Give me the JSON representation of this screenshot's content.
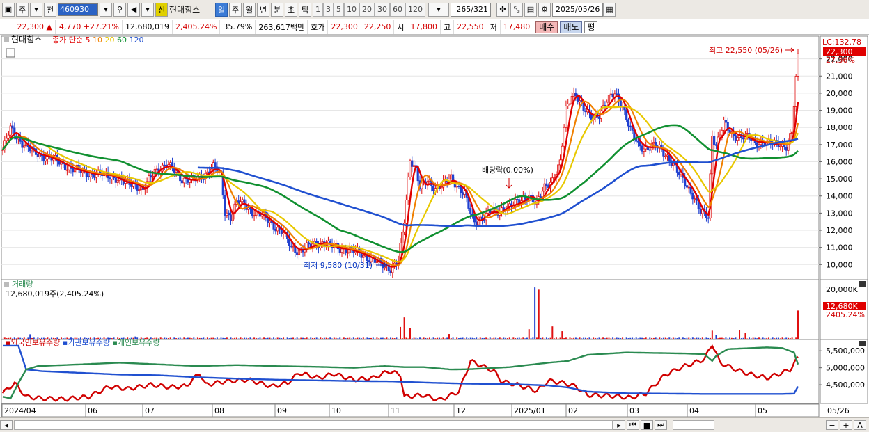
{
  "toolbar": {
    "type_label": "주",
    "whole_label": "전",
    "code": "460930",
    "sin_label": "신",
    "name": "현대힘스",
    "period_tabs": [
      "일",
      "주",
      "월",
      "년",
      "분",
      "초",
      "틱"
    ],
    "active_tab": "일",
    "intervals": [
      "1",
      "3",
      "5",
      "10",
      "20",
      "30",
      "60",
      "120"
    ],
    "count": "265",
    "total": "/321",
    "date": "2025/05/26"
  },
  "quote": {
    "price": "22,300",
    "change": "4,770",
    "change_pct": "+27.21%",
    "volume": "12,680,019",
    "volume_pct": "2,405.24%",
    "turnover_pct": "35.79%",
    "amount": "263,617백만",
    "ask_label": "호가",
    "ask1": "22,300",
    "ask2": "22,250",
    "open_label": "시",
    "open": "17,800",
    "high_label": "고",
    "high": "22,550",
    "low_label": "저",
    "low": "17,480",
    "buy_label": "매수",
    "sell_label": "매도",
    "eval_label": "평"
  },
  "chart_data": {
    "type": "line",
    "title": "현대힘스",
    "legend": {
      "price_legend": "종가 단순",
      "ma_periods": [
        "5",
        "10",
        "20",
        "60",
        "120"
      ],
      "ma_colors": [
        "#e00000",
        "#f08000",
        "#e8c800",
        "#109030",
        "#2050d0"
      ]
    },
    "ylim": [
      9200,
      23000
    ],
    "y_ticks": [
      "10,000",
      "11,000",
      "12,000",
      "13,000",
      "14,000",
      "15,000",
      "16,000",
      "17,000",
      "18,000",
      "19,000",
      "20,000",
      "21,000",
      "22,000"
    ],
    "lc_label": "LC:132.78",
    "last_price_label": "22,300",
    "last_pct_label": "27.36%",
    "x_ticks": [
      "2024/04",
      "06",
      "07",
      "08",
      "09",
      "10",
      "11",
      "12",
      "2025/01",
      "02",
      "03",
      "04",
      "05"
    ],
    "x_end_label": "05/26",
    "annotations": {
      "high": "최고 22,550 (05/26)",
      "low": "최저 9,580 (10/31)",
      "dividend": "배당락(0.00%)"
    },
    "close_series": {
      "name": "종가",
      "points": [
        [
          0,
          16700
        ],
        [
          4,
          17900
        ],
        [
          10,
          17100
        ],
        [
          16,
          16500
        ],
        [
          25,
          16200
        ],
        [
          35,
          15600
        ],
        [
          45,
          15300
        ],
        [
          55,
          15200
        ],
        [
          62,
          14800
        ],
        [
          68,
          14700
        ],
        [
          72,
          14300
        ],
        [
          78,
          15500
        ],
        [
          84,
          15800
        ],
        [
          88,
          15500
        ],
        [
          92,
          15000
        ],
        [
          98,
          14900
        ],
        [
          104,
          15300
        ],
        [
          108,
          15700
        ],
        [
          112,
          15200
        ],
        [
          114,
          13100
        ],
        [
          117,
          12800
        ],
        [
          120,
          13600
        ],
        [
          124,
          13500
        ],
        [
          128,
          13100
        ],
        [
          132,
          12900
        ],
        [
          136,
          12600
        ],
        [
          140,
          12200
        ],
        [
          144,
          11800
        ],
        [
          148,
          11000
        ],
        [
          152,
          10800
        ],
        [
          158,
          11100
        ],
        [
          164,
          11300
        ],
        [
          170,
          11000
        ],
        [
          176,
          10900
        ],
        [
          182,
          10700
        ],
        [
          188,
          10400
        ],
        [
          194,
          10000
        ],
        [
          199,
          9800
        ],
        [
          203,
          10200
        ],
        [
          206,
          12500
        ],
        [
          209,
          16200
        ],
        [
          212,
          15600
        ],
        [
          214,
          14500
        ],
        [
          218,
          14800
        ],
        [
          222,
          14500
        ],
        [
          226,
          14700
        ],
        [
          230,
          15000
        ],
        [
          234,
          14500
        ],
        [
          237,
          14200
        ],
        [
          240,
          12900
        ],
        [
          242,
          12400
        ],
        [
          246,
          12800
        ],
        [
          250,
          13100
        ],
        [
          254,
          13000
        ],
        [
          258,
          13400
        ],
        [
          262,
          13500
        ],
        [
          266,
          13700
        ],
        [
          270,
          14100
        ],
        [
          274,
          13500
        ],
        [
          278,
          14500
        ],
        [
          282,
          15000
        ],
        [
          286,
          15900
        ],
        [
          289,
          19000
        ],
        [
          292,
          19900
        ],
        [
          294,
          20000
        ],
        [
          298,
          19000
        ],
        [
          302,
          18600
        ],
        [
          306,
          18800
        ],
        [
          310,
          19500
        ],
        [
          314,
          20000
        ],
        [
          318,
          19300
        ],
        [
          322,
          17800
        ],
        [
          326,
          17000
        ],
        [
          330,
          16800
        ],
        [
          334,
          16900
        ],
        [
          338,
          16700
        ],
        [
          342,
          16200
        ],
        [
          346,
          15400
        ],
        [
          350,
          14800
        ],
        [
          354,
          14100
        ],
        [
          358,
          13000
        ],
        [
          362,
          12800
        ],
        [
          364,
          17600
        ],
        [
          366,
          17000
        ],
        [
          370,
          18200
        ],
        [
          374,
          17600
        ],
        [
          378,
          17500
        ],
        [
          382,
          17400
        ],
        [
          386,
          17100
        ],
        [
          390,
          17200
        ],
        [
          394,
          17000
        ],
        [
          398,
          17100
        ],
        [
          402,
          16900
        ],
        [
          405,
          17700
        ],
        [
          408,
          22300
        ]
      ]
    },
    "volume": {
      "label": "거래량",
      "value_label": "12,680,019주(2,405.24%)",
      "axis_label": "20,000K",
      "last_label": "12,680K",
      "last_pct": "2405.24%",
      "spikes": [
        [
          14,
          2100
        ],
        [
          68,
          1200
        ],
        [
          204,
          5000
        ],
        [
          206,
          8800
        ],
        [
          209,
          4500
        ],
        [
          229,
          2200
        ],
        [
          270,
          4100
        ],
        [
          273,
          20700
        ],
        [
          275,
          19800
        ],
        [
          282,
          5200
        ],
        [
          287,
          3300
        ],
        [
          364,
          3500
        ],
        [
          366,
          1800
        ],
        [
          378,
          3800
        ],
        [
          381,
          2600
        ],
        [
          408,
          11500
        ]
      ],
      "ylim": [
        0,
        21000
      ]
    },
    "holdings": {
      "legend": [
        "외국인보유수량",
        "기관보유수량",
        "개인보유수량"
      ],
      "colors": [
        "#d00000",
        "#2050d0",
        "#2a8a50"
      ],
      "y_ticks": [
        "5,500,000",
        "5,000,000",
        "4,500,000"
      ],
      "ylim": [
        3950000,
        5750000
      ],
      "foreign": [
        [
          0,
          4250000
        ],
        [
          6,
          4550000
        ],
        [
          12,
          4150000
        ],
        [
          20,
          4100000
        ],
        [
          32,
          4080000
        ],
        [
          44,
          4150000
        ],
        [
          55,
          4450000
        ],
        [
          64,
          4380000
        ],
        [
          76,
          4500000
        ],
        [
          86,
          4430000
        ],
        [
          94,
          4460000
        ],
        [
          101,
          4850000
        ],
        [
          104,
          4500000
        ],
        [
          114,
          4600000
        ],
        [
          126,
          4650000
        ],
        [
          138,
          4450000
        ],
        [
          146,
          4550000
        ],
        [
          152,
          4850000
        ],
        [
          162,
          4700000
        ],
        [
          170,
          4820000
        ],
        [
          180,
          4650000
        ],
        [
          190,
          4700000
        ],
        [
          198,
          4900000
        ],
        [
          204,
          4800000
        ],
        [
          206,
          4150000
        ],
        [
          216,
          4200000
        ],
        [
          224,
          4050000
        ],
        [
          234,
          4300000
        ],
        [
          240,
          5200000
        ],
        [
          246,
          5050000
        ],
        [
          252,
          4900000
        ],
        [
          256,
          4600000
        ],
        [
          264,
          4500000
        ],
        [
          274,
          4320000
        ],
        [
          280,
          4620000
        ],
        [
          288,
          4550000
        ],
        [
          294,
          4450000
        ],
        [
          300,
          4200000
        ],
        [
          312,
          4180000
        ],
        [
          322,
          4120000
        ],
        [
          330,
          4250000
        ],
        [
          340,
          4800000
        ],
        [
          350,
          5050000
        ],
        [
          360,
          5250000
        ],
        [
          364,
          5700000
        ],
        [
          368,
          5150000
        ],
        [
          376,
          4950000
        ],
        [
          384,
          4800000
        ],
        [
          392,
          4700000
        ],
        [
          400,
          4850000
        ],
        [
          404,
          4950000
        ],
        [
          408,
          5300000
        ]
      ],
      "institution": [
        [
          0,
          5650000
        ],
        [
          8,
          5650000
        ],
        [
          12,
          4950000
        ],
        [
          20,
          4900000
        ],
        [
          40,
          4850000
        ],
        [
          60,
          4800000
        ],
        [
          80,
          4780000
        ],
        [
          100,
          4720000
        ],
        [
          120,
          4680000
        ],
        [
          140,
          4650000
        ],
        [
          160,
          4630000
        ],
        [
          180,
          4610000
        ],
        [
          200,
          4600000
        ],
        [
          220,
          4560000
        ],
        [
          240,
          4530000
        ],
        [
          260,
          4520000
        ],
        [
          280,
          4480000
        ],
        [
          290,
          4420000
        ],
        [
          300,
          4300000
        ],
        [
          320,
          4250000
        ],
        [
          340,
          4240000
        ],
        [
          360,
          4230000
        ],
        [
          380,
          4230000
        ],
        [
          400,
          4230000
        ],
        [
          406,
          4240000
        ],
        [
          408,
          4450000
        ]
      ],
      "individual": [
        [
          0,
          4150000
        ],
        [
          4,
          4100000
        ],
        [
          8,
          4550000
        ],
        [
          12,
          4950000
        ],
        [
          18,
          5050000
        ],
        [
          40,
          5100000
        ],
        [
          60,
          5150000
        ],
        [
          80,
          5100000
        ],
        [
          100,
          5050000
        ],
        [
          120,
          5080000
        ],
        [
          140,
          5050000
        ],
        [
          160,
          5030000
        ],
        [
          180,
          5000000
        ],
        [
          196,
          5050000
        ],
        [
          206,
          5020000
        ],
        [
          216,
          5020000
        ],
        [
          230,
          4950000
        ],
        [
          240,
          4960000
        ],
        [
          260,
          5020000
        ],
        [
          280,
          5150000
        ],
        [
          290,
          5200000
        ],
        [
          300,
          5380000
        ],
        [
          320,
          5450000
        ],
        [
          340,
          5430000
        ],
        [
          350,
          5420000
        ],
        [
          360,
          5400000
        ],
        [
          364,
          5200000
        ],
        [
          366,
          5350000
        ],
        [
          372,
          5550000
        ],
        [
          392,
          5600000
        ],
        [
          400,
          5580000
        ],
        [
          406,
          5450000
        ],
        [
          408,
          5100000
        ]
      ]
    }
  }
}
